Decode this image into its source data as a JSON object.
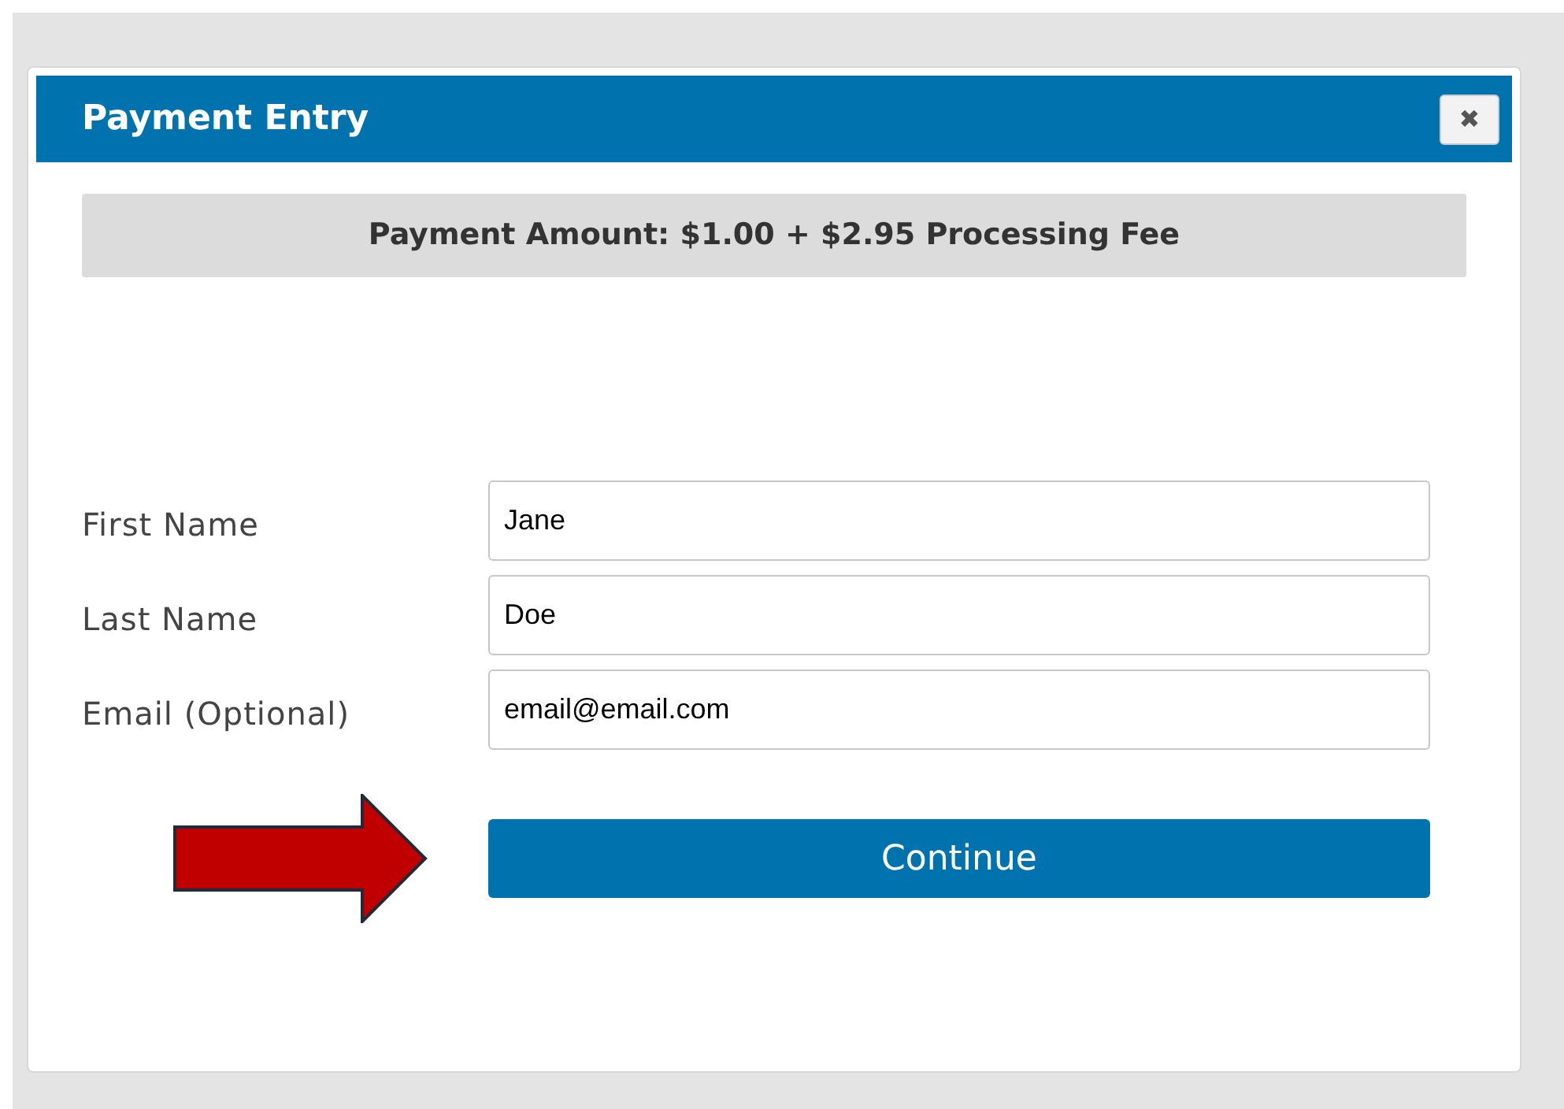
{
  "dialog": {
    "title": "Payment Entry",
    "close_label": "✖"
  },
  "amount_banner": "Payment Amount: $1.00 + $2.95 Processing Fee",
  "fields": [
    {
      "label": "First Name",
      "value": "Jane"
    },
    {
      "label": "Last Name",
      "value": "Doe"
    },
    {
      "label": "Email (Optional)",
      "value": "email@email.com"
    }
  ],
  "continue_button": "Continue"
}
